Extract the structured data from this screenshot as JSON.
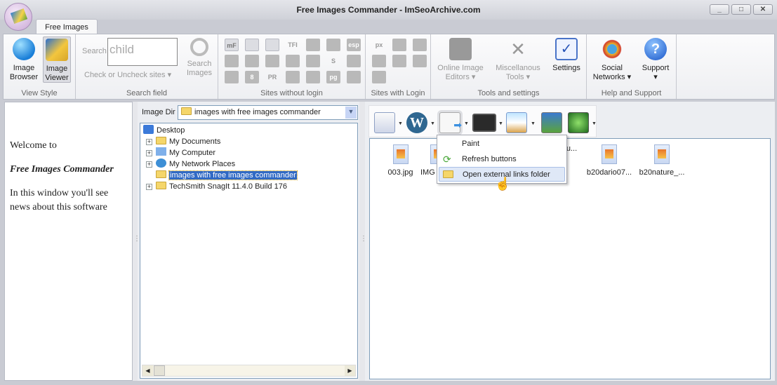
{
  "window": {
    "title": "Free Images Commander - ImSeoArchive.com",
    "minimize": "_",
    "maximize": "□",
    "close": "✕"
  },
  "ribbon": {
    "tab": "Free Images",
    "view_style": {
      "label": "View Style",
      "image_browser": "Image Browser",
      "image_viewer": "Image Viewer"
    },
    "search": {
      "label": "Search field",
      "search_prefix": "Search",
      "value": "child",
      "check_sites": "Check or Uncheck sites",
      "search_images": "Search Images"
    },
    "sites_without_login": {
      "label": "Sites without login",
      "icons": [
        "mF",
        "",
        "",
        "TFI",
        "",
        "",
        "esp",
        "",
        "",
        "",
        "",
        "",
        "S",
        "",
        "",
        "8",
        "PR",
        "",
        "",
        "pg",
        ""
      ]
    },
    "sites_with_login": {
      "label": "Sites with Login",
      "icons": [
        "px",
        "",
        "",
        "",
        "",
        "",
        ""
      ]
    },
    "tools": {
      "label": "Tools and settings",
      "online_editors": "Online Image Editors",
      "misc_tools": "Miscellanous Tools",
      "settings": "Settings"
    },
    "help": {
      "label": "Help and Support",
      "social": "Social Networks",
      "support": "Support"
    }
  },
  "left_pane": {
    "welcome": "Welcome to",
    "app_name": "Free Images Commander",
    "news": "In this window you'll see news about this software"
  },
  "image_dir": {
    "label": "Image Dir",
    "value": "images with free images commander"
  },
  "tree": [
    {
      "label": "Desktop",
      "icon": "desktop-icon"
    },
    {
      "label": "My Documents",
      "icon": "documents-icon"
    },
    {
      "label": "My Computer",
      "icon": "computer-icon"
    },
    {
      "label": "My Network Places",
      "icon": "network-icon"
    },
    {
      "label": "images with free images commander",
      "icon": "folder-icon",
      "selected": true
    },
    {
      "label": "TechSmith SnagIt 11.4.0 Build 176",
      "icon": "folder-icon"
    }
  ],
  "toolbar": {
    "buttons": [
      "palette",
      "wordpress",
      "external-links",
      "console",
      "image-viewer",
      "image-settings",
      "screensaver"
    ]
  },
  "files": [
    "003.jpg",
    "IMG",
    "u...",
    "b20dario07...",
    "b20nature_..."
  ],
  "menu": {
    "items": [
      {
        "label": "Paint",
        "icon": ""
      },
      {
        "label": "Refresh buttons",
        "icon": "refresh-icon"
      },
      {
        "label": "Open external links folder",
        "icon": "folder-icon",
        "highlighted": true
      }
    ]
  },
  "colors": {
    "selection": "#316ac5",
    "menu_highlight": "#dfe8f7"
  }
}
